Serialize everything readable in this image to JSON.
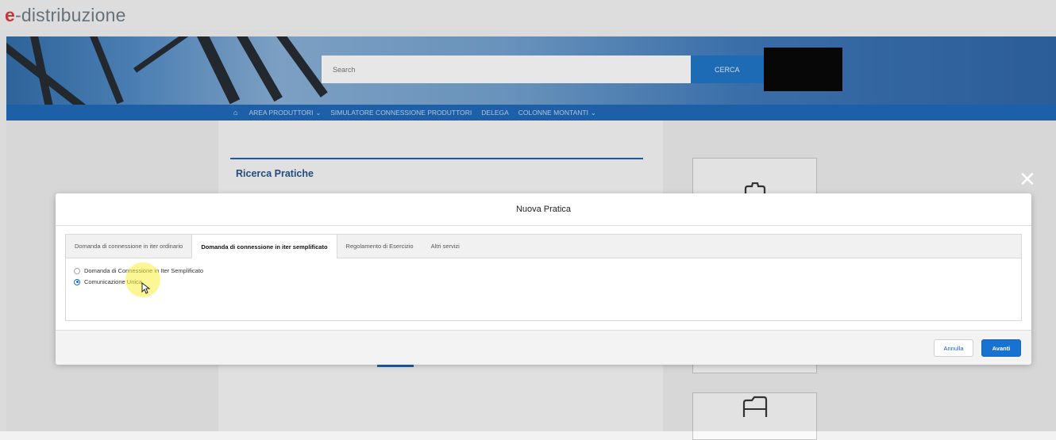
{
  "site": {
    "logo_prefix": "e",
    "logo_text": "-distribuzione",
    "brand_color": "#d9363e"
  },
  "search": {
    "placeholder": "Search",
    "button_label": "CERCA"
  },
  "nav": {
    "items": [
      {
        "label": "AREA PRODUTTORI",
        "dropdown": true
      },
      {
        "label": "SIMULATORE CONNESSIONE PRODUTTORI",
        "dropdown": false
      },
      {
        "label": "DELEGA",
        "dropdown": false
      },
      {
        "label": "COLONNE MONTANTI",
        "dropdown": true
      }
    ]
  },
  "page": {
    "section_title": "Ricerca Pratiche"
  },
  "modal": {
    "title": "Nuova Pratica",
    "tabs": [
      {
        "label": "Domanda di connessione in iter ordinario",
        "active": false
      },
      {
        "label": "Domanda di connessione in iter semplificato",
        "active": true
      },
      {
        "label": "Regolamento di Esercizio",
        "active": false
      },
      {
        "label": "Altri servizi",
        "active": false
      }
    ],
    "options": [
      {
        "label": "Domanda di Connessione in Iter Semplificato",
        "checked": false
      },
      {
        "label": "Comunicazione Unica",
        "checked": true
      }
    ],
    "cancel_label": "Annulla",
    "next_label": "Avanti"
  },
  "icons": {
    "home": "home-icon",
    "close": "close-icon",
    "clipboard": "clipboard-icon",
    "folder": "folder-icon"
  },
  "colors": {
    "primary_blue": "#1a72d0",
    "nav_blue": "#1a66b8"
  }
}
